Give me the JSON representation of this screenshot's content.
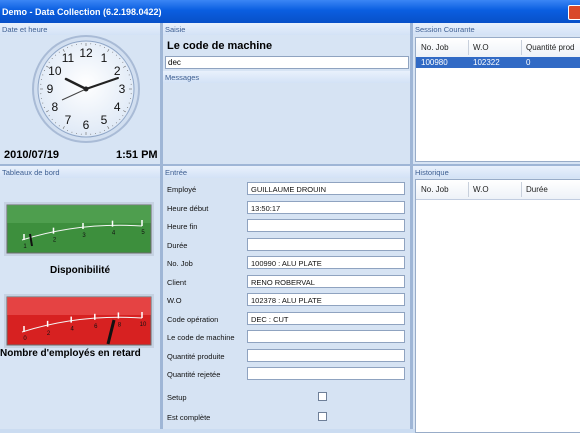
{
  "window": {
    "title": "Demo - Data Collection (6.2.198.0422)"
  },
  "date_heure": {
    "header": "Date et heure",
    "date": "2010/07/19",
    "time": "1:51 PM",
    "clock_numbers": [
      "12",
      "1",
      "2",
      "3",
      "4",
      "5",
      "6",
      "7",
      "8",
      "9",
      "10",
      "11"
    ]
  },
  "saisie": {
    "header": "Saisie",
    "prompt": "Le code de machine",
    "input_value": "dec",
    "messages_header": "Messages"
  },
  "session": {
    "header": "Session Courante",
    "columns": [
      "No. Job",
      "W.O",
      "Quantité prod"
    ],
    "rows": [
      [
        "100980",
        "102322",
        "0"
      ]
    ]
  },
  "tableaux": {
    "header": "Tableaux de bord",
    "gauge1": {
      "label": "Disponibilité",
      "scale": [
        "1",
        "2",
        "3",
        "4",
        "5"
      ],
      "color": "#2e8b2e"
    },
    "gauge2": {
      "label": "Nombre d'employés en retard",
      "scale": [
        "0",
        "2",
        "4",
        "6",
        "8",
        "10"
      ],
      "color": "#e02020"
    }
  },
  "entree": {
    "header": "Entrée",
    "fields": [
      {
        "label": "Employé",
        "value": "GUILLAUME DROUIN"
      },
      {
        "label": "Heure début",
        "value": "13:50:17"
      },
      {
        "label": "Heure fin",
        "value": ""
      },
      {
        "label": "Durée",
        "value": ""
      },
      {
        "label": "No. Job",
        "value": "100990 : ALU PLATE"
      },
      {
        "label": "Client",
        "value": "RENO ROBERVAL"
      },
      {
        "label": "W.O",
        "value": "102378 : ALU PLATE"
      },
      {
        "label": "Code opération",
        "value": "DEC : CUT"
      },
      {
        "label": "Le code de machine",
        "value": ""
      },
      {
        "label": "Quantité produite",
        "value": ""
      },
      {
        "label": "Quantité rejetée",
        "value": ""
      }
    ],
    "checkboxes": [
      {
        "label": "Setup"
      },
      {
        "label": "Est complète"
      }
    ]
  },
  "historique": {
    "header": "Historique",
    "columns": [
      "No. Job",
      "W.O",
      "Durée"
    ]
  }
}
